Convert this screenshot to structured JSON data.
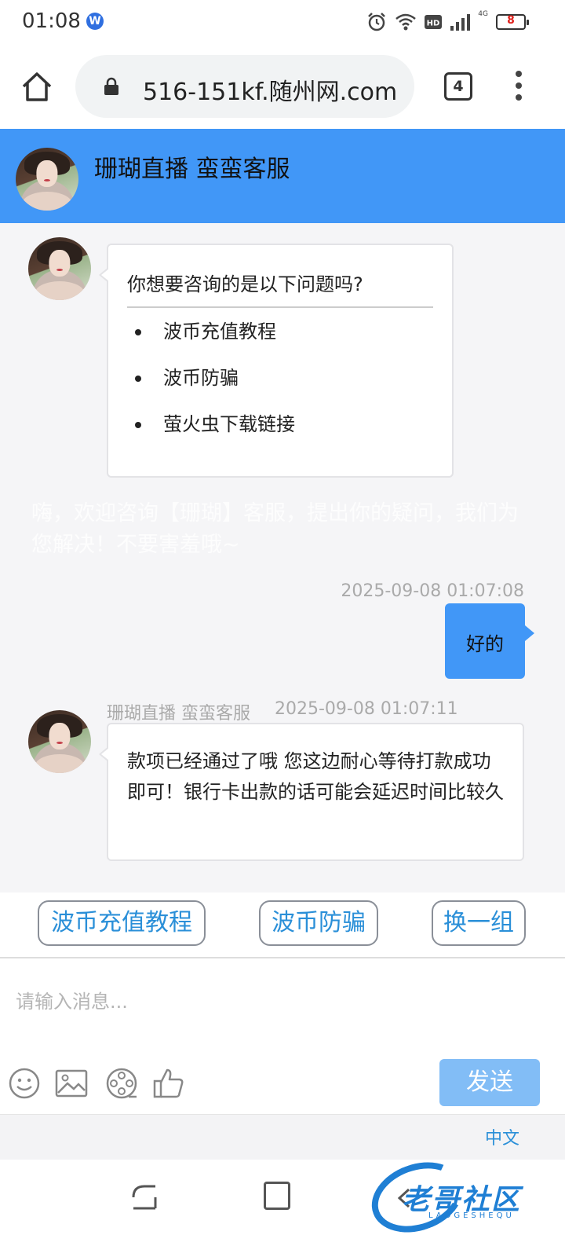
{
  "status_bar": {
    "time": "01:08",
    "app_badge": "W",
    "network_label": "4G",
    "hd_label": "HD",
    "battery": "8"
  },
  "browser": {
    "url": "516-151kf.随州网.com",
    "tab_count": "4"
  },
  "chat_header": {
    "title": "珊瑚直播 蛮蛮客服"
  },
  "messages": {
    "faq": {
      "title": "你想要咨询的是以下问题吗?",
      "items": [
        "波币充值教程",
        "波币防骗",
        "萤火虫下载链接"
      ]
    },
    "welcome": "嗨，欢迎咨询【珊瑚】客服，提出你的疑问，我们为您解决！不要害羞哦~",
    "user_reply": {
      "timestamp": "2025-09-08 01:07:08",
      "text": "好的"
    },
    "agent_reply": {
      "sender": "珊瑚直播 蛮蛮客服",
      "timestamp": "2025-09-08 01:07:11",
      "text": "款项已经通过了哦  您这边耐心等待打款成功即可！银行卡出款的话可能会延迟时间比较久"
    }
  },
  "quick_replies": [
    "波币充值教程",
    "波币防骗",
    "换一组"
  ],
  "composer": {
    "placeholder": "请输入消息...",
    "send_label": "发送",
    "tools": [
      "smiley-icon",
      "image-icon",
      "film-reel-icon",
      "thumbs-up-icon"
    ]
  },
  "language": {
    "label": "中文"
  },
  "watermark": {
    "text": "老哥社区",
    "sub": "LAOGESHEQU"
  },
  "colors": {
    "header_bg": "#4197f7",
    "user_bubble": "#4197f7",
    "chip_text": "#2a8fd8",
    "send_button": "#82bdf6"
  }
}
